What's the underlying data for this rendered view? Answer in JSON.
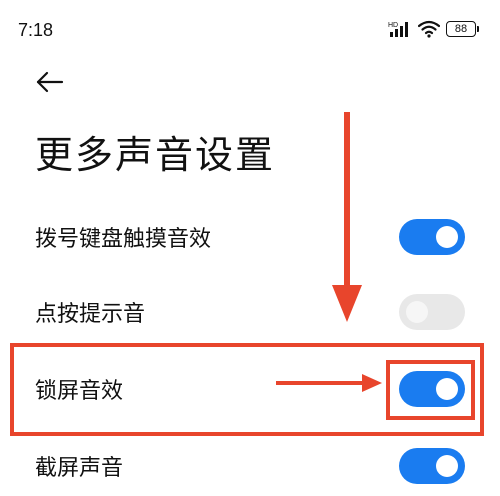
{
  "status_bar": {
    "time": "7:18",
    "network_label": "HD",
    "battery": "88"
  },
  "header": {
    "back_icon": "arrow-left-icon",
    "title": "更多声音设置"
  },
  "settings": [
    {
      "label": "拨号键盘触摸音效",
      "enabled": true
    },
    {
      "label": "点按提示音",
      "enabled": false
    },
    {
      "label": "锁屏音效",
      "enabled": true
    },
    {
      "label": "截屏声音",
      "enabled": true
    }
  ],
  "colors": {
    "toggle_on": "#1a7cf0",
    "toggle_off": "#e8e8e8",
    "annotation": "#e8452c"
  }
}
